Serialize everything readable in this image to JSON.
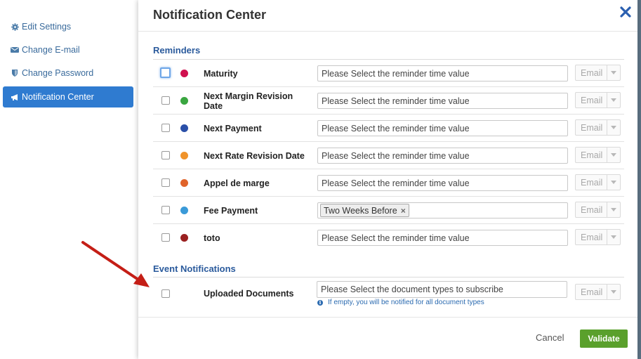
{
  "sidebar": {
    "items": [
      {
        "label": "Edit Settings",
        "icon": "gear-icon",
        "active": false
      },
      {
        "label": "Change E-mail",
        "icon": "envelope-icon",
        "active": false
      },
      {
        "label": "Change Password",
        "icon": "shield-icon",
        "active": false
      },
      {
        "label": "Notification Center",
        "icon": "megaphone-icon",
        "active": true
      }
    ]
  },
  "modal": {
    "title": "Notification Center",
    "close_icon": "close-icon",
    "reminders_title": "Reminders",
    "event_title": "Event Notifications",
    "reminder_placeholder": "Please Select the reminder time value",
    "select_value": "Email",
    "reminders": [
      {
        "label": "Maturity",
        "color": "#d0104f",
        "checked": false,
        "value": ""
      },
      {
        "label": "Next Margin Revision Date",
        "color": "#3aa640",
        "checked": false,
        "value": ""
      },
      {
        "label": "Next Payment",
        "color": "#2a4fa8",
        "checked": false,
        "value": ""
      },
      {
        "label": "Next Rate Revision Date",
        "color": "#f0932a",
        "checked": false,
        "value": ""
      },
      {
        "label": "Appel de marge",
        "color": "#e0632a",
        "checked": false,
        "value": ""
      },
      {
        "label": "Fee Payment",
        "color": "#3a9ad8",
        "checked": false,
        "value": "Two Weeks Before"
      },
      {
        "label": "toto",
        "color": "#9a2020",
        "checked": false,
        "value": ""
      }
    ],
    "events": [
      {
        "label": "Uploaded Documents",
        "checked": false,
        "placeholder": "Please Select the document types to subscribe",
        "hint": "If empty, you will be notified for all document types"
      }
    ],
    "footer": {
      "cancel_label": "Cancel",
      "validate_label": "Validate",
      "validate_color": "#5aa02c"
    }
  },
  "colors": {
    "accent": "#2f7bd0",
    "section_title": "#2a5a9c",
    "annotation_arrow": "#c41e16"
  }
}
